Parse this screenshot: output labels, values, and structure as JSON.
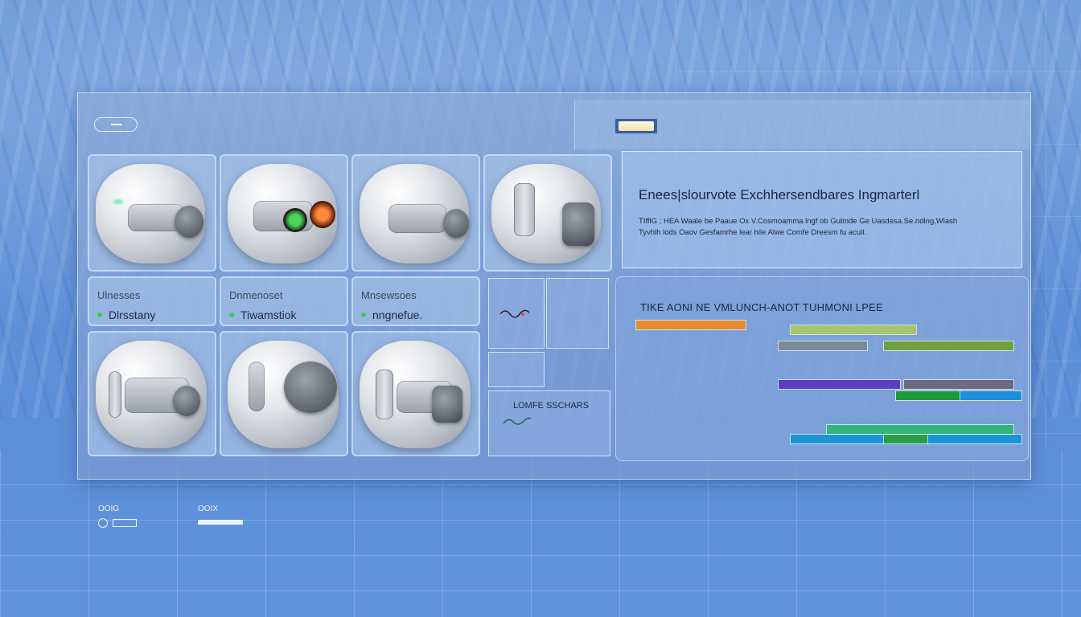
{
  "devices": {
    "labels": [
      {
        "title": "Ulnesses",
        "status": "Dlrsstany"
      },
      {
        "title": "Dnmenoset",
        "status": "Tiwamstiok"
      },
      {
        "title": "Mnsewsoes",
        "status": "nngnefue."
      }
    ]
  },
  "side_panel": {
    "label": "LOMFE SSCHARS"
  },
  "info": {
    "title": "Enees|slourvote Exchhersendbares Ingmarterl",
    "body_line1": "TIfflG ; HEA Waale be Paaue Ox V.Cosmoamma lngf ob Gulmde Ge Uasdesa.Se.ndlng,Wlash",
    "body_line2": "Tyvhlh lods Oaov Gesfamrhe lear hile Alwe Comfe Dreesm fu acull."
  },
  "chart": {
    "title": "TIKE AONI NE VMLUNCH-ANOT TUHMONI LPEE"
  },
  "chart_data": {
    "type": "bar",
    "title": "TIKE AONI NE VMLUNCH-ANOT TUHMONI LPEE",
    "orientation": "horizontal-ranges",
    "series": [
      {
        "start": 0.05,
        "end": 0.32,
        "color": "#e98a2d"
      },
      {
        "start": 0.43,
        "end": 0.74,
        "color": "#a6c56c"
      },
      {
        "start": 0.4,
        "end": 0.62,
        "color": "#7b8a95"
      },
      {
        "start": 0.66,
        "end": 0.98,
        "color": "#6fa03a"
      },
      {
        "start": 0.4,
        "end": 0.7,
        "color": "#5b3ec4"
      },
      {
        "start": 0.71,
        "end": 0.98,
        "color": "#6e6a7f"
      },
      {
        "start": 0.69,
        "end": 0.85,
        "color": "#1f9a3a"
      },
      {
        "start": 0.85,
        "end": 1.0,
        "color": "#1f8ed8"
      },
      {
        "start": 0.52,
        "end": 0.98,
        "color": "#2fb57a"
      },
      {
        "start": 0.43,
        "end": 0.66,
        "color": "#1a96d6"
      },
      {
        "start": 0.66,
        "end": 0.77,
        "color": "#2a9d4a"
      },
      {
        "start": 0.77,
        "end": 1.0,
        "color": "#1a96d6"
      }
    ]
  },
  "footer": {
    "icon_a": "OOIG",
    "icon_b": "OOIX"
  }
}
